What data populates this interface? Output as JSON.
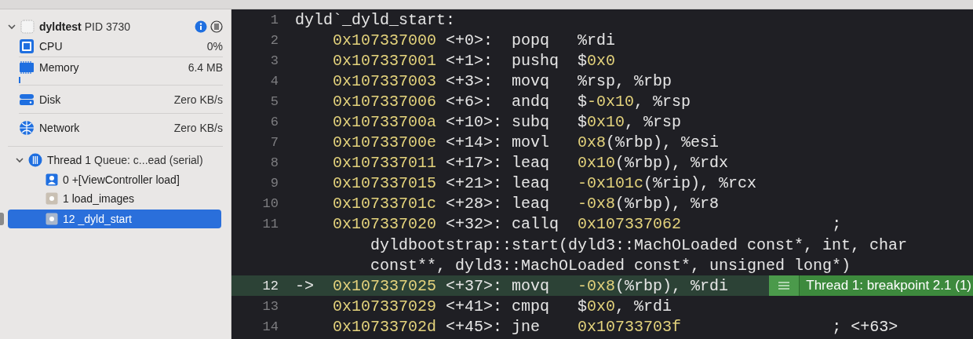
{
  "process": {
    "name": "dyldtest",
    "pid": "PID 3730",
    "expanded": true
  },
  "gauges": [
    {
      "kind": "cpu",
      "label": "CPU",
      "value": "0%"
    },
    {
      "kind": "memory",
      "label": "Memory",
      "value": "6.4 MB",
      "level": 0.01
    },
    {
      "kind": "disk",
      "label": "Disk",
      "value": "Zero KB/s"
    },
    {
      "kind": "network",
      "label": "Network",
      "value": "Zero KB/s"
    }
  ],
  "thread": {
    "label": "Thread 1",
    "queue": "Queue: c...ead (serial)",
    "expanded": true,
    "frames": [
      {
        "kind": "user",
        "label": "0 +[ViewController load]",
        "selected": false
      },
      {
        "kind": "system",
        "label": "1 load_images",
        "selected": false
      },
      {
        "kind": "system",
        "label": "12 _dyld_start",
        "selected": true
      }
    ]
  },
  "code": {
    "breakpoint": {
      "label": "Thread 1: breakpoint 2.1 (1)"
    },
    "lines": [
      {
        "kind": "label",
        "number": "1",
        "current": false,
        "segments": [
          {
            "kind": "text",
            "text": "dyld`_dyld_start:"
          }
        ]
      },
      {
        "kind": "instruction",
        "number": "2",
        "current": false,
        "segments": [
          {
            "kind": "address",
            "text": "0x107337000"
          },
          {
            "kind": "text",
            "text": " <+0>:  popq   %rdi"
          }
        ]
      },
      {
        "kind": "instruction",
        "number": "3",
        "current": false,
        "segments": [
          {
            "kind": "address",
            "text": "0x107337001"
          },
          {
            "kind": "text",
            "text": " <+1>:  pushq  $"
          },
          {
            "kind": "number",
            "text": "0x0"
          }
        ]
      },
      {
        "kind": "instruction",
        "number": "4",
        "current": false,
        "segments": [
          {
            "kind": "address",
            "text": "0x107337003"
          },
          {
            "kind": "text",
            "text": " <+3>:  movq   %rsp, %rbp"
          }
        ]
      },
      {
        "kind": "instruction",
        "number": "5",
        "current": false,
        "segments": [
          {
            "kind": "address",
            "text": "0x107337006"
          },
          {
            "kind": "text",
            "text": " <+6>:  andq   $"
          },
          {
            "kind": "number",
            "text": "-0x10"
          },
          {
            "kind": "text",
            "text": ", %rsp"
          }
        ]
      },
      {
        "kind": "instruction",
        "number": "6",
        "current": false,
        "segments": [
          {
            "kind": "address",
            "text": "0x10733700a"
          },
          {
            "kind": "text",
            "text": " <+10>: subq   $"
          },
          {
            "kind": "number",
            "text": "0x10"
          },
          {
            "kind": "text",
            "text": ", %rsp"
          }
        ]
      },
      {
        "kind": "instruction",
        "number": "7",
        "current": false,
        "segments": [
          {
            "kind": "address",
            "text": "0x10733700e"
          },
          {
            "kind": "text",
            "text": " <+14>: movl   "
          },
          {
            "kind": "number",
            "text": "0x8"
          },
          {
            "kind": "text",
            "text": "(%rbp), %esi"
          }
        ]
      },
      {
        "kind": "instruction",
        "number": "8",
        "current": false,
        "segments": [
          {
            "kind": "address",
            "text": "0x107337011"
          },
          {
            "kind": "text",
            "text": " <+17>: leaq   "
          },
          {
            "kind": "number",
            "text": "0x10"
          },
          {
            "kind": "text",
            "text": "(%rbp), %rdx"
          }
        ]
      },
      {
        "kind": "instruction",
        "number": "9",
        "current": false,
        "segments": [
          {
            "kind": "address",
            "text": "0x107337015"
          },
          {
            "kind": "text",
            "text": " <+21>: leaq   "
          },
          {
            "kind": "number",
            "text": "-0x101c"
          },
          {
            "kind": "text",
            "text": "(%rip), %rcx"
          }
        ]
      },
      {
        "kind": "instruction",
        "number": "10",
        "current": false,
        "segments": [
          {
            "kind": "address",
            "text": "0x10733701c"
          },
          {
            "kind": "text",
            "text": " <+28>: leaq   "
          },
          {
            "kind": "number",
            "text": "-0x8"
          },
          {
            "kind": "text",
            "text": "(%rbp), %r8"
          }
        ]
      },
      {
        "kind": "instruction",
        "number": "11",
        "current": false,
        "segments": [
          {
            "kind": "address",
            "text": "0x107337020"
          },
          {
            "kind": "text",
            "text": " <+32>: callq  "
          },
          {
            "kind": "number",
            "text": "0x107337062"
          },
          {
            "kind": "text",
            "text": "                ;"
          }
        ]
      },
      {
        "kind": "continuation",
        "current": false,
        "segments": [
          {
            "kind": "text",
            "text": "dyldbootstrap::start(dyld3::MachOLoaded const*, int, char"
          }
        ]
      },
      {
        "kind": "continuation",
        "current": false,
        "segments": [
          {
            "kind": "text",
            "text": "const**, dyld3::MachOLoaded const*, unsigned long*)"
          }
        ]
      },
      {
        "kind": "instruction",
        "number": "12",
        "current": true,
        "marker": "->",
        "segments": [
          {
            "kind": "address",
            "text": "0x107337025"
          },
          {
            "kind": "text",
            "text": " <+37>: movq   "
          },
          {
            "kind": "number",
            "text": "-0x8"
          },
          {
            "kind": "text",
            "text": "(%rbp), %rdi"
          }
        ]
      },
      {
        "kind": "instruction",
        "number": "13",
        "current": false,
        "segments": [
          {
            "kind": "address",
            "text": "0x107337029"
          },
          {
            "kind": "text",
            "text": " <+41>: cmpq   $"
          },
          {
            "kind": "number",
            "text": "0x0"
          },
          {
            "kind": "text",
            "text": ", %rdi"
          }
        ]
      },
      {
        "kind": "instruction",
        "number": "14",
        "current": false,
        "segments": [
          {
            "kind": "address",
            "text": "0x10733702d"
          },
          {
            "kind": "text",
            "text": " <+45>: jne    "
          },
          {
            "kind": "number",
            "text": "0x10733703f"
          },
          {
            "kind": "text",
            "text": "                ; <+63>"
          }
        ]
      }
    ]
  }
}
